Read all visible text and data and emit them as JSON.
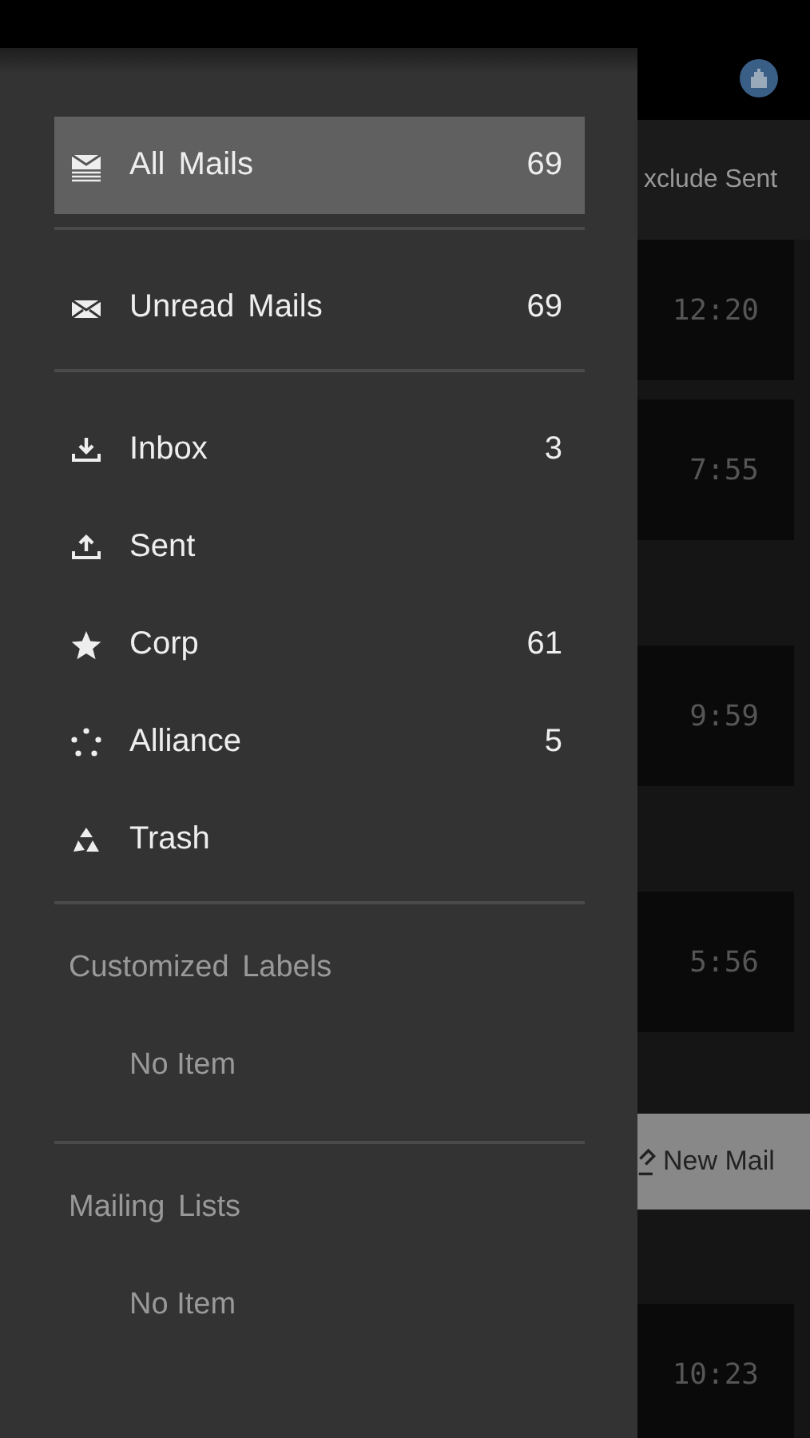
{
  "drawer": {
    "top_items": [
      {
        "kind": "all",
        "label": "All Mails",
        "count": "69",
        "selected": true
      },
      {
        "kind": "unread",
        "label": "Unread Mails",
        "count": "69",
        "selected": false
      }
    ],
    "folders": [
      {
        "kind": "inbox",
        "label": "Inbox",
        "count": "3",
        "selected": false
      },
      {
        "kind": "sent",
        "label": "Sent",
        "selected": false
      },
      {
        "kind": "corp",
        "label": "Corp",
        "count": "61",
        "selected": false
      },
      {
        "kind": "alliance",
        "label": "Alliance",
        "count": "5",
        "selected": false
      },
      {
        "kind": "trash",
        "label": "Trash",
        "selected": false
      }
    ],
    "sections": [
      {
        "title": "Customized Labels",
        "empty_text": "No Item"
      },
      {
        "title": "Mailing Lists",
        "empty_text": "No Item"
      }
    ]
  },
  "background": {
    "filter_label": "xclude Sent",
    "mails": [
      {
        "time": "12:20"
      },
      {
        "time": "7:55"
      },
      {
        "time": "9:59"
      },
      {
        "time": "5:56"
      },
      {
        "time": "10:23"
      }
    ],
    "new_mail_button": "New Mail"
  }
}
